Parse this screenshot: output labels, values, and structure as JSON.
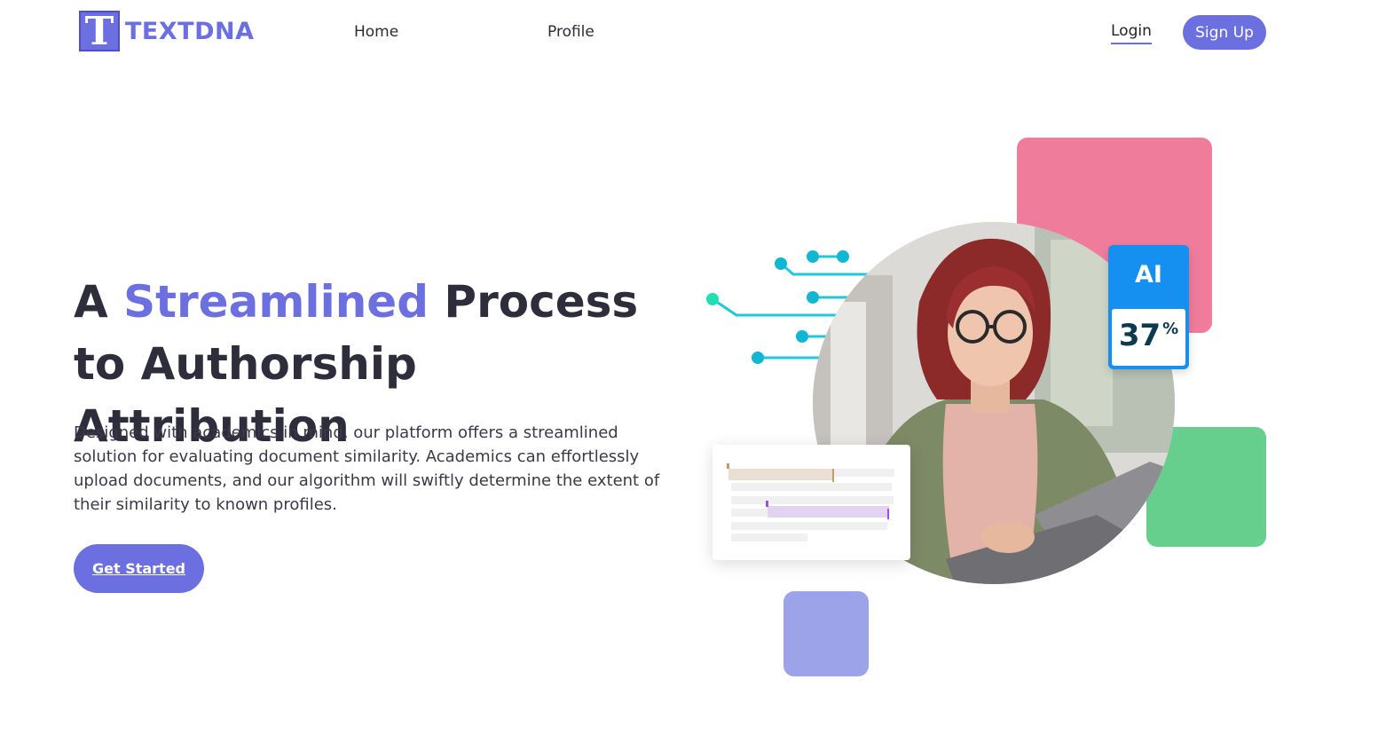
{
  "header": {
    "logo_letter": "T",
    "logo_text": "TEXTDNA",
    "nav": [
      {
        "label": "Home"
      },
      {
        "label": "Profile"
      }
    ],
    "login_label": "Login",
    "signup_label": "Sign Up"
  },
  "hero": {
    "title_part1": "A ",
    "title_accent": "Streamlined",
    "title_part2": " Process to Authorship Attribution",
    "description": "Designed with academics in mind, our platform offers a streamlined solution for evaluating document similarity. Academics can effortlessly upload documents, and our algorithm will swiftly determine the extent of their similarity to known profiles.",
    "cta_label": "Get Started"
  },
  "illustration": {
    "ai_label": "AI",
    "ai_value": "37",
    "ai_unit": "%",
    "colors": {
      "accent": "#6c6fe0",
      "pink": "#f07c9c",
      "green": "#67cf8d",
      "lavender": "#9da3e8",
      "ai_blue": "#1690f0",
      "circuit": "#1ec8d8"
    }
  }
}
